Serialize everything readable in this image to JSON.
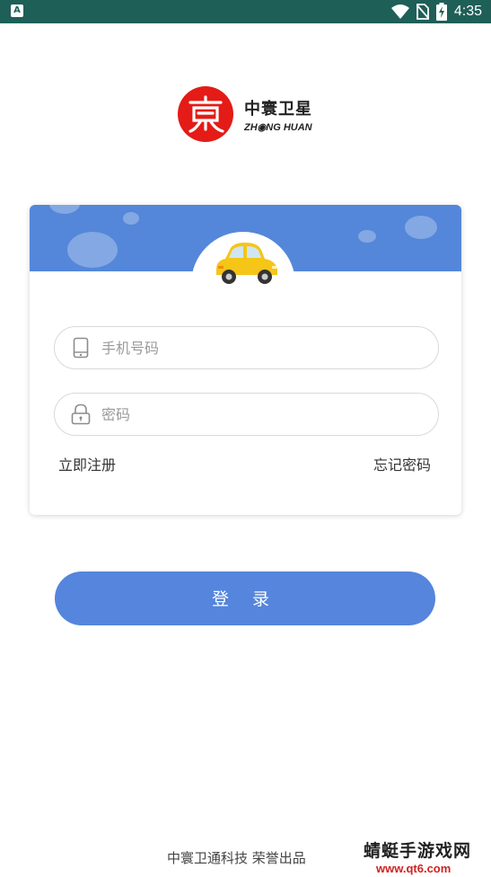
{
  "status_bar": {
    "app_badge": "A",
    "time": "4:35"
  },
  "logo": {
    "name_cn": "中寰卫星",
    "name_en": "ZH◉NG HUAN"
  },
  "login_form": {
    "phone_placeholder": "手机号码",
    "password_placeholder": "密码",
    "register_link": "立即注册",
    "forgot_link": "忘记密码"
  },
  "login_button": "登 录",
  "footer": "中寰卫通科技 荣誉出品",
  "watermark": {
    "text": "蜻蜓手游戏网",
    "url": "www.qt6.com"
  },
  "colors": {
    "status_bar": "#1e5f57",
    "primary": "#5585dc",
    "logo_red": "#e41b17",
    "car_yellow": "#f5c518"
  }
}
